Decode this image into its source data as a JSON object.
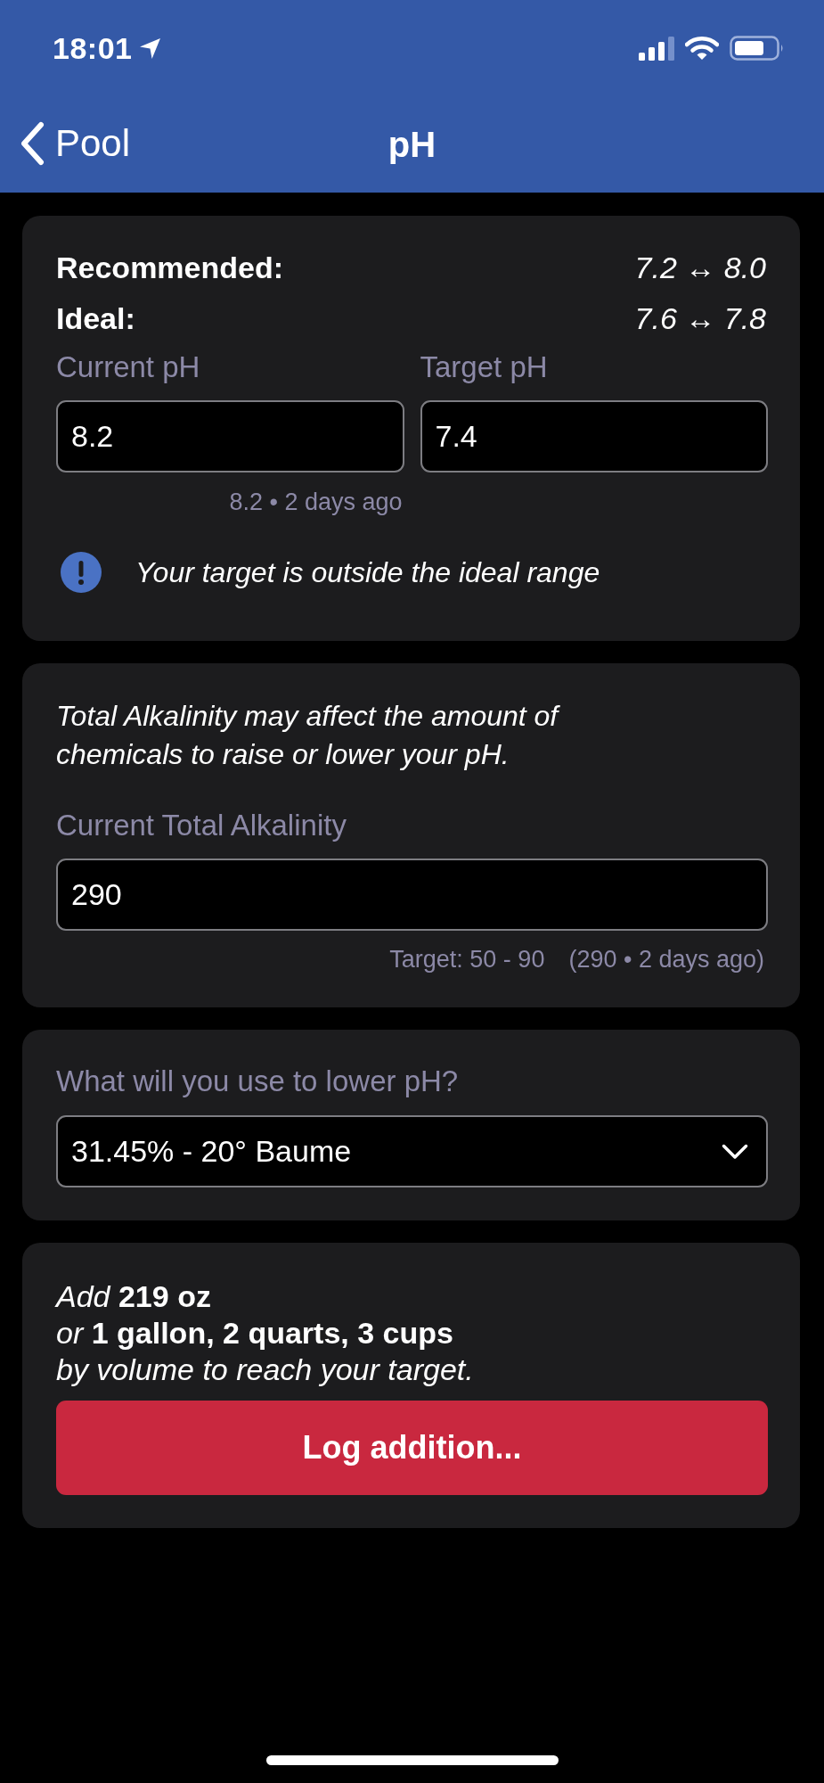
{
  "status_bar": {
    "time": "18:01"
  },
  "nav_bar": {
    "back_label": "Pool",
    "title": "pH"
  },
  "range_card": {
    "ranges": [
      {
        "label": "Recommended:",
        "value": "7.2 ↔ 8.0"
      },
      {
        "label": "Ideal:",
        "value": "7.6 ↔ 7.8"
      }
    ],
    "fields": [
      {
        "label": "Current pH",
        "value": "8.2",
        "hint": "8.2 • 2 days ago"
      },
      {
        "label": "Target pH",
        "value": "7.4"
      }
    ],
    "warning": "Your target is outside the ideal range"
  },
  "alkalinity_card": {
    "note": "Total Alkalinity may affect the amount of chemicals to raise or lower your pH.",
    "field": {
      "label": "Current Total Alkalinity",
      "value": "290"
    },
    "hints": [
      "Target: 50 - 90",
      "(290 • 2 days ago)"
    ]
  },
  "chemical_card": {
    "label": "What will you use to lower pH?",
    "selection": "31.45% - 20° Baume"
  },
  "dosage_card": {
    "lines": [
      "*Add* **219 oz**",
      "*or* **1 gallon, 2 quarts, 3 cups**",
      "*by volume to reach your target.*"
    ],
    "button": "Log addition..."
  }
}
